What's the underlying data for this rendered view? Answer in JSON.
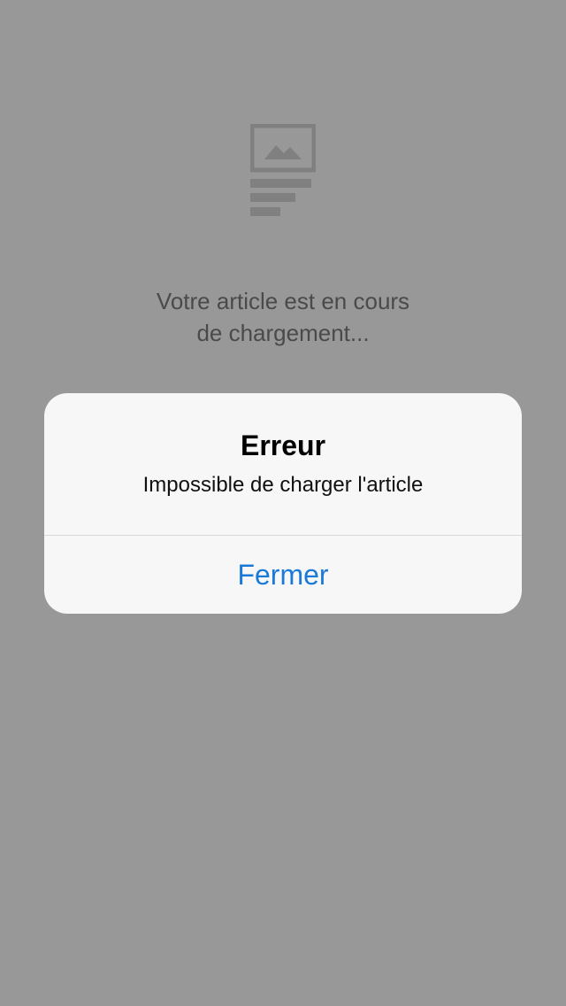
{
  "screen": {
    "background_color": "#989898"
  },
  "loading": {
    "icon": "article-placeholder-icon",
    "line1": "Votre article est en cours",
    "line2": "de chargement..."
  },
  "alert": {
    "title": "Erreur",
    "message": "Impossible de charger l'article",
    "button_label": "Fermer",
    "button_color": "#1b7ad8",
    "background_color": "#f7f7f7"
  }
}
